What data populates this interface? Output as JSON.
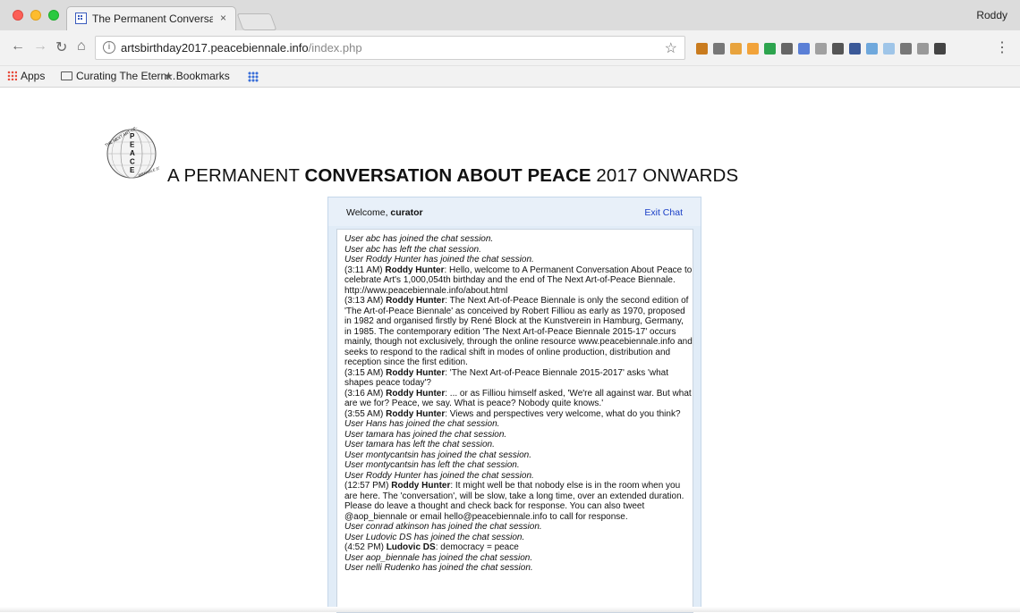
{
  "browser": {
    "tab_title": "The Permanent Conversation A",
    "tab_close": "×",
    "profile_name": "Roddy",
    "url_host": "artsbirthday2017.peacebiennale.info",
    "url_path": "/index.php",
    "info_glyph": "i",
    "bookmarks": {
      "apps": "Apps",
      "folder": "Curating The Etern...",
      "bookmarks": "Bookmarks"
    },
    "extension_colors": [
      "#c97b1e",
      "#777777",
      "#e8a33d",
      "#f2a33a",
      "#2da44e",
      "#666666",
      "#5a7fd6",
      "#a0a0a0",
      "#555555",
      "#3b5998",
      "#6fa8dc",
      "#9fc5e8",
      "#777777",
      "#999999",
      "#444444"
    ]
  },
  "page": {
    "heading_pre": "A PERMANENT ",
    "heading_bold": "CONVERSATION ABOUT PEACE",
    "heading_post": " 2017 ONWARDS",
    "logo_text": {
      "top": "THE NEXT ART-OF-",
      "letters": [
        "P",
        "E",
        "A",
        "C",
        "E"
      ],
      "bottom": "BIENNALE 2015-2017"
    }
  },
  "chat": {
    "welcome_prefix": "Welcome, ",
    "username": "curator",
    "exit_label": "Exit Chat",
    "messages": [
      {
        "type": "sys",
        "text": "User abc has joined the chat session."
      },
      {
        "type": "sys",
        "text": "User abc has left the chat session."
      },
      {
        "type": "sys",
        "text": "User Roddy Hunter has joined the chat session."
      },
      {
        "type": "msg",
        "time": "(3:11 AM) ",
        "name": "Roddy Hunter",
        "text": ": Hello, welcome to A Permanent Conversation About Peace to celebrate Art's 1,000,054th birthday and the end of The Next Art-of-Peace Biennale. http://www.peacebiennale.info/about.html"
      },
      {
        "type": "msg",
        "time": "(3:13 AM) ",
        "name": "Roddy Hunter",
        "text": ": The Next Art-of-Peace Biennale is only the second edition of 'The Art-of-Peace Biennale' as conceived by Robert Filliou as early as 1970, proposed in 1982 and organised firstly by René Block at the Kunstverein in Hamburg, Germany, in 1985. The contemporary edition 'The Next Art-of-Peace Biennale 2015-17' occurs mainly, though not exclusively, through the online resource www.peacebiennale.info and seeks to respond to the radical shift in modes of online production, distribution and reception since the first edition."
      },
      {
        "type": "msg",
        "time": "(3:15 AM) ",
        "name": "Roddy Hunter",
        "text": ": 'The Next Art-of-Peace Biennale 2015-2017' asks 'what shapes peace today'?"
      },
      {
        "type": "msg",
        "time": "(3:16 AM) ",
        "name": "Roddy Hunter",
        "text": ": ... or as Filliou himself asked, 'We're all against war. But what are we for? Peace, we say. What is peace? Nobody quite knows.'"
      },
      {
        "type": "msg",
        "time": "(3:55 AM) ",
        "name": "Roddy Hunter",
        "text": ": Views and perspectives very welcome, what do you think?"
      },
      {
        "type": "sys",
        "text": "User Hans has joined the chat session."
      },
      {
        "type": "sys",
        "text": "User tamara has joined the chat session."
      },
      {
        "type": "sys",
        "text": "User tamara has left the chat session."
      },
      {
        "type": "sys",
        "text": "User montycantsin has joined the chat session."
      },
      {
        "type": "sys",
        "text": "User montycantsin has left the chat session."
      },
      {
        "type": "sys",
        "text": "User Roddy Hunter has joined the chat session."
      },
      {
        "type": "msg",
        "time": "(12:57 PM) ",
        "name": "Roddy Hunter",
        "text": ": It might well be that nobody else is in the room when you are here. The 'conversation', will be slow, take a long time, over an extended duration. Please do leave a thought and check back for response. You can also tweet @aop_biennale or email hello@peacebiennale.info to call for response."
      },
      {
        "type": "sys",
        "text": "User conrad atkinson has joined the chat session."
      },
      {
        "type": "sys",
        "text": "User Ludovic DS has joined the chat session."
      },
      {
        "type": "msg",
        "time": "(4:52 PM) ",
        "name": "Ludovic DS",
        "text": ": democracy = peace"
      },
      {
        "type": "sys",
        "text": "User aop_biennale has joined the chat session."
      },
      {
        "type": "sys",
        "text": "User nelli Rudenko has joined the chat session."
      }
    ]
  }
}
